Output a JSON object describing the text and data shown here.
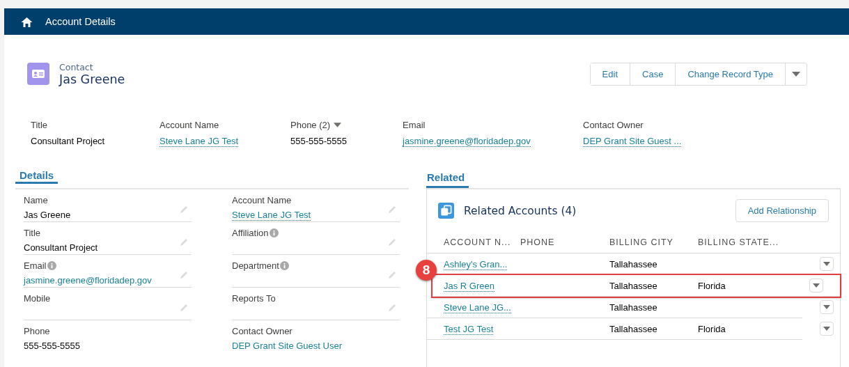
{
  "nav": {
    "title": "Account Details"
  },
  "record": {
    "object_type": "Contact",
    "name": "Jas Greene"
  },
  "actions": [
    {
      "label": "Edit"
    },
    {
      "label": "Case"
    },
    {
      "label": "Change Record Type"
    }
  ],
  "highlights": [
    {
      "label": "Title",
      "value": "Consultant Project",
      "kind": "text",
      "dropdown": false
    },
    {
      "label": "Account Name",
      "value": "Steve Lane JG Test",
      "kind": "link",
      "dropdown": false
    },
    {
      "label": "Phone (2)",
      "value": "555-555-5555",
      "kind": "text",
      "dropdown": true
    },
    {
      "label": "Email",
      "value": "jasmine.greene@floridadep.gov",
      "kind": "link",
      "dropdown": false
    },
    {
      "label": "Contact Owner",
      "value": "DEP Grant Site Guest ...",
      "kind": "link",
      "dropdown": false
    }
  ],
  "details": {
    "tab": "Details",
    "fields": [
      {
        "label": "Name",
        "value": "Jas Greene",
        "kind": "text",
        "info": false
      },
      {
        "label": "Account Name",
        "value": "Steve Lane JG Test",
        "kind": "link",
        "info": false
      },
      {
        "label": "Title",
        "value": "Consultant Project",
        "kind": "text",
        "info": false
      },
      {
        "label": "Affiliation",
        "info": true
      },
      {
        "label": "Email",
        "value": "jasmine.greene@floridadep.gov",
        "kind": "link",
        "info": true
      },
      {
        "label": "Department",
        "info": true
      },
      {
        "label": "Mobile",
        "info": false
      },
      {
        "label": "Reports To",
        "info": false
      },
      {
        "label": "Phone",
        "value": "555-555-5555",
        "kind": "text",
        "info": false
      },
      {
        "label": "Contact Owner",
        "value": "DEP Grant Site Guest User",
        "kind": "link",
        "info": false
      }
    ]
  },
  "related": {
    "tab": "Related",
    "title": "Related Accounts (4)",
    "button": "Add Relationship",
    "columns": [
      "ACCOUNT N...",
      "PHONE",
      "BILLING CITY",
      "BILLING STATE..."
    ],
    "rows": [
      {
        "account_name": "Ashley's Gran...",
        "billing_city": "Tallahassee",
        "highlighted": false
      },
      {
        "account_name": "Jas R Green",
        "billing_city": "Tallahassee",
        "billing_state": "Florida",
        "highlighted": true,
        "callout": "8"
      },
      {
        "account_name": "Steve Lane JG...",
        "billing_city": "Tallahassee",
        "highlighted": false
      },
      {
        "account_name": "Test JG Test",
        "billing_city": "Tallahassee",
        "billing_state": "Florida",
        "highlighted": false
      }
    ]
  }
}
